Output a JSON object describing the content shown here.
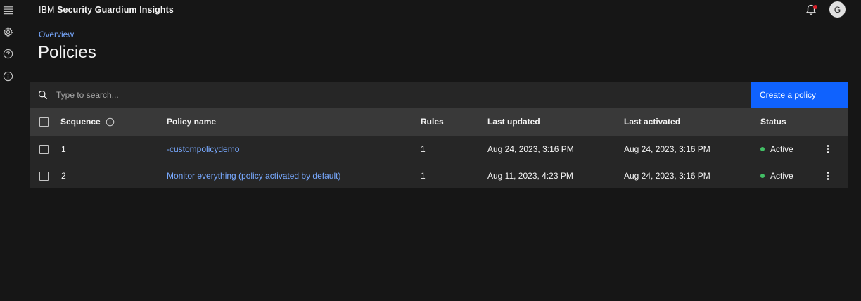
{
  "app": {
    "brand_ibm": "IBM",
    "brand_product": "Security Guardium Insights",
    "avatar_initial": "G"
  },
  "rail": {
    "icons": [
      "menu-icon",
      "settings-icon",
      "help-icon",
      "info-icon"
    ]
  },
  "breadcrumb": "Overview",
  "page_title": "Policies",
  "search": {
    "placeholder": "Type to search..."
  },
  "create_button": "Create a policy",
  "table": {
    "headers": {
      "sequence": "Sequence",
      "policy_name": "Policy name",
      "rules": "Rules",
      "last_updated": "Last updated",
      "last_activated": "Last activated",
      "status": "Status"
    },
    "rows": [
      {
        "sequence": "1",
        "policy_name": "-custompolicydemo",
        "rules": "1",
        "last_updated": "Aug 24, 2023, 3:16 PM",
        "last_activated": "Aug 24, 2023, 3:16 PM",
        "status": "Active"
      },
      {
        "sequence": "2",
        "policy_name": "Monitor everything (policy activated by default)",
        "rules": "1",
        "last_updated": "Aug 11, 2023, 4:23 PM",
        "last_activated": "Aug 24, 2023, 3:16 PM",
        "status": "Active"
      }
    ]
  },
  "colors": {
    "background": "#161616",
    "accent": "#0f62fe",
    "link": "#78a9ff",
    "status_active": "#42be65",
    "notification": "#da1e28"
  }
}
